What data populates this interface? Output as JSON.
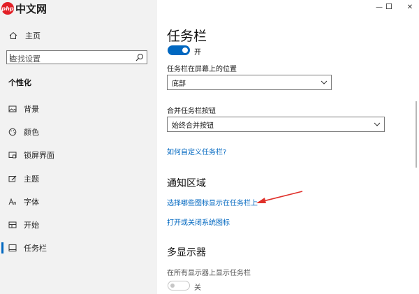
{
  "watermark": {
    "badge_text": "php",
    "brand_text": "中文网"
  },
  "sidebar": {
    "home_label": "主页",
    "search_placeholder": "查找设置",
    "section_title": "个性化",
    "items": [
      {
        "label": "背景",
        "icon": "image-icon"
      },
      {
        "label": "颜色",
        "icon": "palette-icon"
      },
      {
        "label": "锁屏界面",
        "icon": "lock-screen-icon"
      },
      {
        "label": "主题",
        "icon": "theme-icon"
      },
      {
        "label": "字体",
        "icon": "font-icon"
      },
      {
        "label": "开始",
        "icon": "start-icon"
      },
      {
        "label": "任务栏",
        "icon": "taskbar-icon",
        "active": true
      }
    ]
  },
  "window_controls": {
    "minimize": "—",
    "maximize": "☐",
    "close": "✕"
  },
  "main": {
    "title": "任务栏",
    "top_toggle": {
      "state": "开",
      "on": true
    },
    "position_label": "任务栏在屏幕上的位置",
    "position_value": "底部",
    "combine_label": "合并任务栏按钮",
    "combine_value": "始终合并按钮",
    "customize_link": "如何自定义任务栏?",
    "notification_heading": "通知区域",
    "select_icons_link": "选择哪些图标显示在任务栏上",
    "system_icons_link": "打开或关闭系统图标",
    "multi_display_heading": "多显示器",
    "show_all_label": "在所有显示器上显示任务栏",
    "bottom_toggle": {
      "state": "关",
      "on": false
    }
  },
  "colors": {
    "accent": "#0067c0",
    "sidebar_bg": "#f2f2f2",
    "arrow": "#e0302a"
  }
}
